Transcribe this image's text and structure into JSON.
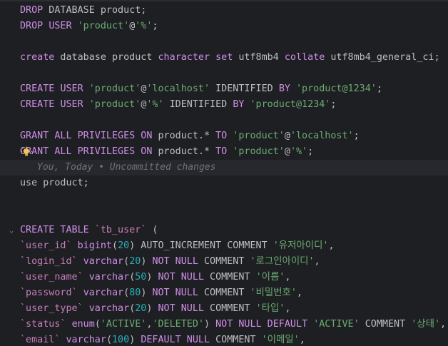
{
  "editor": {
    "language": "sql",
    "colors": {
      "background": "#1e1f22",
      "keyword": "#cf8ee8",
      "string": "#6aab73",
      "number": "#2aacb8",
      "identifier": "#c77dbb",
      "text": "#bcbec4",
      "comment": "#6f737a"
    },
    "inline_hint": "You, Today • Uncommitted changes",
    "lines": [
      {
        "tokens": [
          [
            "kw",
            "DROP"
          ],
          [
            "plain",
            " DATABASE product;"
          ]
        ]
      },
      {
        "tokens": [
          [
            "kw",
            "DROP"
          ],
          [
            "plain",
            " "
          ],
          [
            "kw",
            "USER"
          ],
          [
            "plain",
            " "
          ],
          [
            "str",
            "'product'"
          ],
          [
            "plain",
            "@"
          ],
          [
            "str",
            "'%'"
          ],
          [
            "plain",
            ";"
          ]
        ]
      },
      {
        "tokens": []
      },
      {
        "tokens": [
          [
            "kw",
            "create"
          ],
          [
            "plain",
            " database product "
          ],
          [
            "kw",
            "character set"
          ],
          [
            "plain",
            " utf8mb4 "
          ],
          [
            "kw",
            "collate"
          ],
          [
            "plain",
            " utf8mb4_general_ci;"
          ]
        ]
      },
      {
        "tokens": []
      },
      {
        "tokens": [
          [
            "kw",
            "CREATE"
          ],
          [
            "plain",
            " "
          ],
          [
            "kw",
            "USER"
          ],
          [
            "plain",
            " "
          ],
          [
            "str",
            "'product'"
          ],
          [
            "plain",
            "@"
          ],
          [
            "str",
            "'localhost'"
          ],
          [
            "plain",
            " IDENTIFIED "
          ],
          [
            "kw",
            "BY"
          ],
          [
            "plain",
            " "
          ],
          [
            "str",
            "'product@1234'"
          ],
          [
            "plain",
            ";"
          ]
        ]
      },
      {
        "tokens": [
          [
            "kw",
            "CREATE"
          ],
          [
            "plain",
            " "
          ],
          [
            "kw",
            "USER"
          ],
          [
            "plain",
            " "
          ],
          [
            "str",
            "'product'"
          ],
          [
            "plain",
            "@"
          ],
          [
            "str",
            "'%'"
          ],
          [
            "plain",
            " IDENTIFIED "
          ],
          [
            "kw",
            "BY"
          ],
          [
            "plain",
            " "
          ],
          [
            "str",
            "'product@1234'"
          ],
          [
            "plain",
            ";"
          ]
        ]
      },
      {
        "tokens": []
      },
      {
        "tokens": [
          [
            "kw",
            "GRANT ALL PRIVILEGES ON"
          ],
          [
            "plain",
            " product.* "
          ],
          [
            "kw",
            "TO"
          ],
          [
            "plain",
            " "
          ],
          [
            "str",
            "'product'"
          ],
          [
            "plain",
            "@"
          ],
          [
            "str",
            "'localhost'"
          ],
          [
            "plain",
            ";"
          ]
        ]
      },
      {
        "tokens": [
          [
            "kw",
            "GRANT ALL PRIVILEGES ON"
          ],
          [
            "plain",
            " product.* "
          ],
          [
            "kw",
            "TO"
          ],
          [
            "plain",
            " "
          ],
          [
            "str",
            "'product'"
          ],
          [
            "plain",
            "@"
          ],
          [
            "str",
            "'%'"
          ],
          [
            "plain",
            ";"
          ]
        ],
        "bulb": true
      },
      {
        "tokens": [],
        "hint": true
      },
      {
        "tokens": [
          [
            "plain",
            "use product;"
          ]
        ]
      },
      {
        "tokens": []
      },
      {
        "tokens": []
      },
      {
        "tokens": [
          [
            "kw",
            "CREATE TABLE"
          ],
          [
            "plain",
            " "
          ],
          [
            "bt",
            "`tb_user`"
          ],
          [
            "plain",
            " ("
          ]
        ],
        "fold": true
      },
      {
        "tokens": [
          [
            "bt",
            "`user_id`"
          ],
          [
            "plain",
            " "
          ],
          [
            "kw",
            "bigint"
          ],
          [
            "plain",
            "("
          ],
          [
            "num",
            "20"
          ],
          [
            "plain",
            ") AUTO_INCREMENT COMMENT "
          ],
          [
            "str",
            "'유저아이디'"
          ],
          [
            "plain",
            ","
          ]
        ]
      },
      {
        "tokens": [
          [
            "bt",
            "`login_id`"
          ],
          [
            "plain",
            " "
          ],
          [
            "kw",
            "varchar"
          ],
          [
            "plain",
            "("
          ],
          [
            "num",
            "20"
          ],
          [
            "plain",
            ") "
          ],
          [
            "kw",
            "NOT NULL"
          ],
          [
            "plain",
            " COMMENT "
          ],
          [
            "str",
            "'로그인아이디'"
          ],
          [
            "plain",
            ","
          ]
        ]
      },
      {
        "tokens": [
          [
            "bt",
            "`user_name`"
          ],
          [
            "plain",
            " "
          ],
          [
            "kw",
            "varchar"
          ],
          [
            "plain",
            "("
          ],
          [
            "num",
            "50"
          ],
          [
            "plain",
            ") "
          ],
          [
            "kw",
            "NOT NULL"
          ],
          [
            "plain",
            " COMMENT "
          ],
          [
            "str",
            "'이름'"
          ],
          [
            "plain",
            ","
          ]
        ]
      },
      {
        "tokens": [
          [
            "bt",
            "`password`"
          ],
          [
            "plain",
            " "
          ],
          [
            "kw",
            "varchar"
          ],
          [
            "plain",
            "("
          ],
          [
            "num",
            "80"
          ],
          [
            "plain",
            ") "
          ],
          [
            "kw",
            "NOT NULL"
          ],
          [
            "plain",
            " COMMENT "
          ],
          [
            "str",
            "'비밀번호'"
          ],
          [
            "plain",
            ","
          ]
        ]
      },
      {
        "tokens": [
          [
            "bt",
            "`user_type`"
          ],
          [
            "plain",
            " "
          ],
          [
            "kw",
            "varchar"
          ],
          [
            "plain",
            "("
          ],
          [
            "num",
            "20"
          ],
          [
            "plain",
            ") "
          ],
          [
            "kw",
            "NOT NULL"
          ],
          [
            "plain",
            " COMMENT "
          ],
          [
            "str",
            "'타입'"
          ],
          [
            "plain",
            ","
          ]
        ]
      },
      {
        "tokens": [
          [
            "bt",
            "`status`"
          ],
          [
            "plain",
            " "
          ],
          [
            "kw",
            "enum"
          ],
          [
            "plain",
            "("
          ],
          [
            "str",
            "'ACTIVE'"
          ],
          [
            "plain",
            ","
          ],
          [
            "str",
            "'DELETED'"
          ],
          [
            "plain",
            ") "
          ],
          [
            "kw",
            "NOT NULL DEFAULT"
          ],
          [
            "plain",
            " "
          ],
          [
            "str",
            "'ACTIVE'"
          ],
          [
            "plain",
            " COMMENT "
          ],
          [
            "str",
            "'상태'"
          ],
          [
            "plain",
            ","
          ]
        ]
      },
      {
        "tokens": [
          [
            "bt",
            "`email`"
          ],
          [
            "plain",
            " "
          ],
          [
            "kw",
            "varchar"
          ],
          [
            "plain",
            "("
          ],
          [
            "num",
            "100"
          ],
          [
            "plain",
            ") "
          ],
          [
            "kw",
            "DEFAULT NULL"
          ],
          [
            "plain",
            " COMMENT "
          ],
          [
            "str",
            "'이메일'"
          ],
          [
            "plain",
            ","
          ]
        ]
      }
    ]
  }
}
